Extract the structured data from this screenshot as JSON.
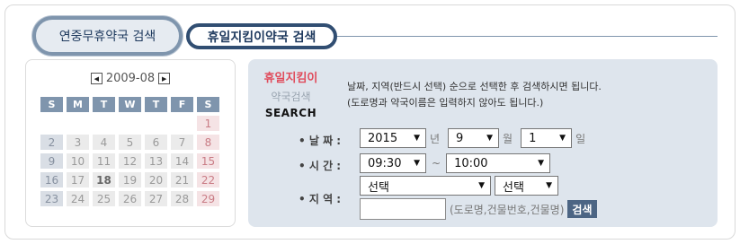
{
  "tabs": [
    {
      "label": "연중무휴약국 검색"
    },
    {
      "label": "휴일지킴이약국 검색"
    }
  ],
  "calendar": {
    "month_label": "2009-08",
    "prev_icon": "◀",
    "next_icon": "▶",
    "weekdays": [
      "S",
      "M",
      "T",
      "W",
      "T",
      "F",
      "S"
    ],
    "rows": [
      [
        "",
        "",
        "",
        "",
        "",
        "",
        "1"
      ],
      [
        "2",
        "3",
        "4",
        "5",
        "6",
        "7",
        "8"
      ],
      [
        "9",
        "10",
        "11",
        "12",
        "13",
        "14",
        "15"
      ],
      [
        "16",
        "17",
        "18",
        "19",
        "20",
        "21",
        "22"
      ],
      [
        "23",
        "24",
        "25",
        "26",
        "27",
        "28",
        "29"
      ]
    ],
    "today": "18"
  },
  "panel": {
    "brand_line1": "휴일지킴이",
    "brand_line2": "약국검색",
    "brand_line3": "SEARCH",
    "desc_line1": "날짜, 지역(반드시 선택) 순으로 선택한 후 검색하시면 됩니다.",
    "desc_line2": "(도로명과 약국이름은 입력하지 않아도 됩니다.)",
    "date_label": "• 날 짜 :",
    "year_value": "2015",
    "year_unit": "년",
    "month_value": "9",
    "month_unit": "월",
    "day_value": "1",
    "day_unit": "일",
    "time_label": "• 시 간 :",
    "time_from": "09:30",
    "time_sep": "~",
    "time_to": "10:00",
    "region_label": "• 지 역 :",
    "region1": "선택",
    "region2": "선택",
    "address_placeholder": "",
    "address_hint": "(도로명,건물번호,건물명)",
    "search_button": "검색",
    "dropdown_arrow": "▼"
  }
}
